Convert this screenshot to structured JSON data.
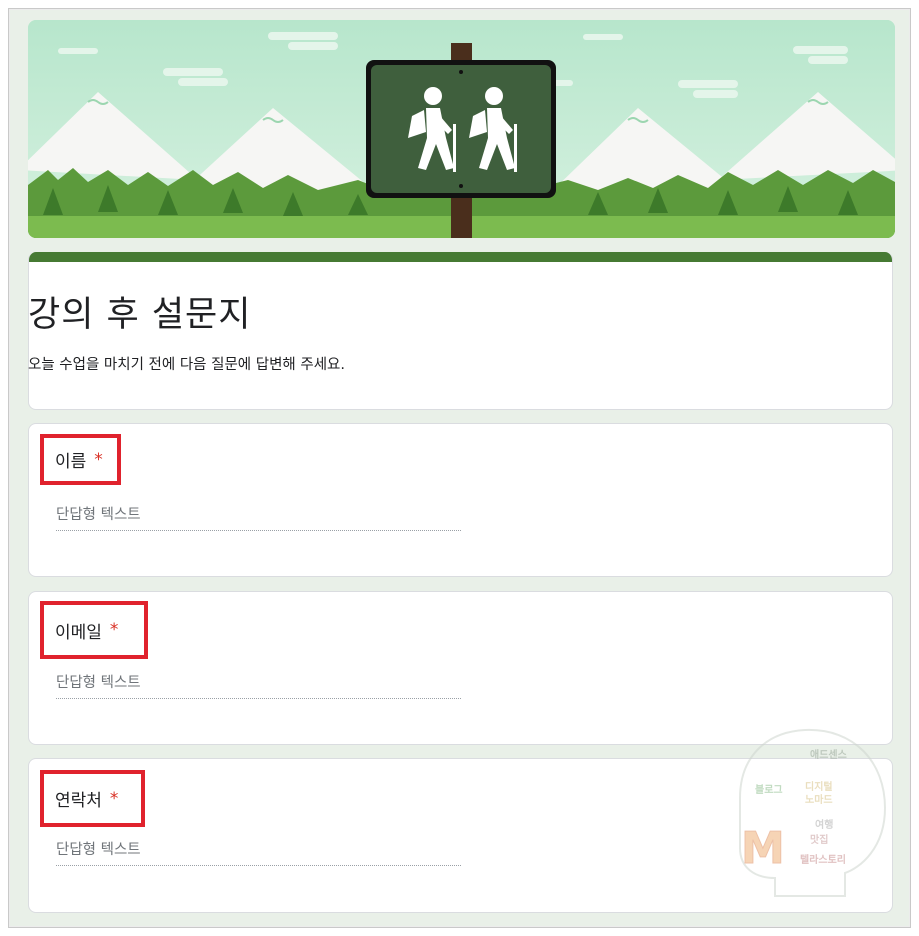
{
  "form": {
    "title": "강의 후 설문지",
    "description": "오늘 수업을 마치기 전에 다음 질문에 답변해 주세요."
  },
  "questions": [
    {
      "label": "이름",
      "required_mark": "*",
      "placeholder": "단답형 텍스트"
    },
    {
      "label": "이메일",
      "required_mark": "*",
      "placeholder": "단답형 텍스트"
    },
    {
      "label": "연락처",
      "required_mark": "*",
      "placeholder": "단답형 텍스트"
    }
  ],
  "header": {
    "image": "hiking-trail-sign-banner",
    "icon": "hikers-icon"
  },
  "watermark": {
    "letter": "M",
    "words": [
      "애드센스",
      "블로그",
      "디지털",
      "노마드",
      "여행",
      "맛집",
      "텔라스토리"
    ]
  },
  "colors": {
    "accent": "#467a33",
    "highlight_box": "#e0222d",
    "required": "#d93025",
    "background": "#e9f0e8"
  }
}
